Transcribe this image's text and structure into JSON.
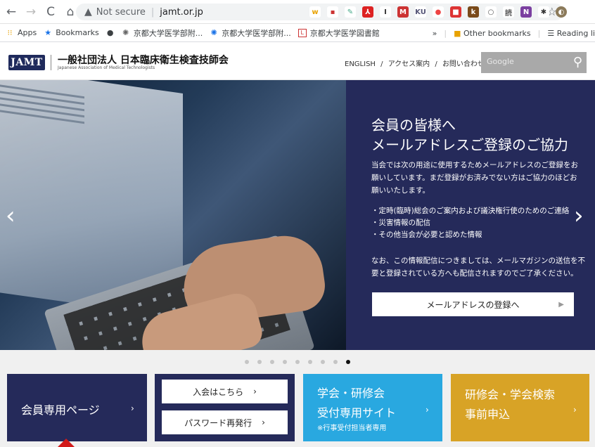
{
  "browser": {
    "url_warning": "Not secure",
    "url": "jamt.or.jp",
    "bookmarks": [
      "Apps",
      "Bookmarks",
      "京都大学医学部附...",
      "京都大学医学部附...",
      "京都大学医学図書館"
    ],
    "bookmarks_right": [
      "»",
      "Other bookmarks",
      "Reading li"
    ]
  },
  "header": {
    "logo": "JAMT",
    "org_name": "一般社団法人 日本臨床衛生検査技師会",
    "org_sub": "Japanese Association of Medical Technologists",
    "links": [
      "ENGLISH",
      "アクセス案内",
      "お問い合わせ"
    ],
    "search_placeholder": "Google"
  },
  "hero": {
    "title_line1": "会員の皆様へ",
    "title_line2": "メールアドレスご登録のご協力",
    "body": "当会では次の用途に使用するためメールアドレスのご登録をお願いしています。まだ登録がお済みでない方はご協力のほどお願いいたします。",
    "list": [
      "・定時(臨時)総会のご案内および議決権行使のためのご連絡",
      "・災害情報の配信",
      "・その他当会が必要と認めた情報"
    ],
    "note": "なお、この情報配信につきましては、メールマガジンの送信を不要と登録されている方へも配信されますのでご了承ください。",
    "button": "メールアドレスの登録へ"
  },
  "tiles": {
    "members": "会員専用ページ",
    "join": "入会はこちら",
    "password": "パスワード再発行",
    "conference_l1": "学会・研修会",
    "conference_l2": "受付専用サイト",
    "conference_l3": "※行事受付担当者専用",
    "search_l1": "研修会・学会検索",
    "search_l2": "事前申込"
  }
}
